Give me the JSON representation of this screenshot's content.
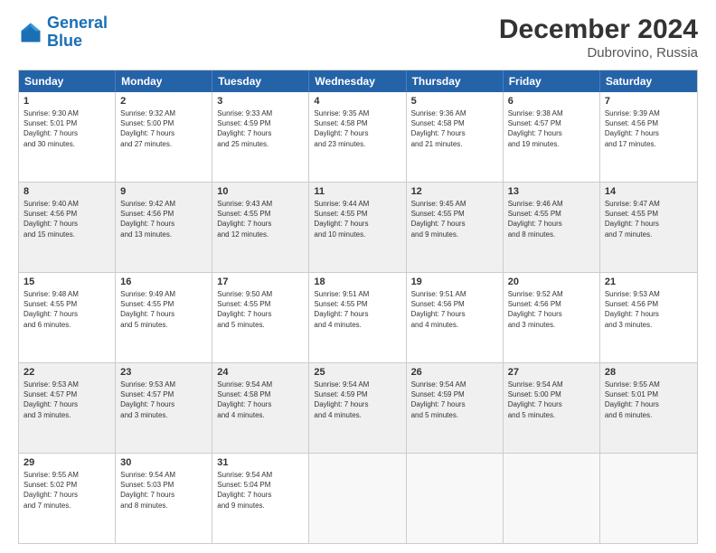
{
  "logo": {
    "line1": "General",
    "line2": "Blue"
  },
  "title": {
    "month": "December 2024",
    "location": "Dubrovino, Russia"
  },
  "header_days": [
    "Sunday",
    "Monday",
    "Tuesday",
    "Wednesday",
    "Thursday",
    "Friday",
    "Saturday"
  ],
  "weeks": [
    [
      {
        "day": "1",
        "text": "Sunrise: 9:30 AM\nSunset: 5:01 PM\nDaylight: 7 hours\nand 30 minutes.",
        "empty": false,
        "shaded": false
      },
      {
        "day": "2",
        "text": "Sunrise: 9:32 AM\nSunset: 5:00 PM\nDaylight: 7 hours\nand 27 minutes.",
        "empty": false,
        "shaded": false
      },
      {
        "day": "3",
        "text": "Sunrise: 9:33 AM\nSunset: 4:59 PM\nDaylight: 7 hours\nand 25 minutes.",
        "empty": false,
        "shaded": false
      },
      {
        "day": "4",
        "text": "Sunrise: 9:35 AM\nSunset: 4:58 PM\nDaylight: 7 hours\nand 23 minutes.",
        "empty": false,
        "shaded": false
      },
      {
        "day": "5",
        "text": "Sunrise: 9:36 AM\nSunset: 4:58 PM\nDaylight: 7 hours\nand 21 minutes.",
        "empty": false,
        "shaded": false
      },
      {
        "day": "6",
        "text": "Sunrise: 9:38 AM\nSunset: 4:57 PM\nDaylight: 7 hours\nand 19 minutes.",
        "empty": false,
        "shaded": false
      },
      {
        "day": "7",
        "text": "Sunrise: 9:39 AM\nSunset: 4:56 PM\nDaylight: 7 hours\nand 17 minutes.",
        "empty": false,
        "shaded": false
      }
    ],
    [
      {
        "day": "8",
        "text": "Sunrise: 9:40 AM\nSunset: 4:56 PM\nDaylight: 7 hours\nand 15 minutes.",
        "empty": false,
        "shaded": true
      },
      {
        "day": "9",
        "text": "Sunrise: 9:42 AM\nSunset: 4:56 PM\nDaylight: 7 hours\nand 13 minutes.",
        "empty": false,
        "shaded": true
      },
      {
        "day": "10",
        "text": "Sunrise: 9:43 AM\nSunset: 4:55 PM\nDaylight: 7 hours\nand 12 minutes.",
        "empty": false,
        "shaded": true
      },
      {
        "day": "11",
        "text": "Sunrise: 9:44 AM\nSunset: 4:55 PM\nDaylight: 7 hours\nand 10 minutes.",
        "empty": false,
        "shaded": true
      },
      {
        "day": "12",
        "text": "Sunrise: 9:45 AM\nSunset: 4:55 PM\nDaylight: 7 hours\nand 9 minutes.",
        "empty": false,
        "shaded": true
      },
      {
        "day": "13",
        "text": "Sunrise: 9:46 AM\nSunset: 4:55 PM\nDaylight: 7 hours\nand 8 minutes.",
        "empty": false,
        "shaded": true
      },
      {
        "day": "14",
        "text": "Sunrise: 9:47 AM\nSunset: 4:55 PM\nDaylight: 7 hours\nand 7 minutes.",
        "empty": false,
        "shaded": true
      }
    ],
    [
      {
        "day": "15",
        "text": "Sunrise: 9:48 AM\nSunset: 4:55 PM\nDaylight: 7 hours\nand 6 minutes.",
        "empty": false,
        "shaded": false
      },
      {
        "day": "16",
        "text": "Sunrise: 9:49 AM\nSunset: 4:55 PM\nDaylight: 7 hours\nand 5 minutes.",
        "empty": false,
        "shaded": false
      },
      {
        "day": "17",
        "text": "Sunrise: 9:50 AM\nSunset: 4:55 PM\nDaylight: 7 hours\nand 5 minutes.",
        "empty": false,
        "shaded": false
      },
      {
        "day": "18",
        "text": "Sunrise: 9:51 AM\nSunset: 4:55 PM\nDaylight: 7 hours\nand 4 minutes.",
        "empty": false,
        "shaded": false
      },
      {
        "day": "19",
        "text": "Sunrise: 9:51 AM\nSunset: 4:56 PM\nDaylight: 7 hours\nand 4 minutes.",
        "empty": false,
        "shaded": false
      },
      {
        "day": "20",
        "text": "Sunrise: 9:52 AM\nSunset: 4:56 PM\nDaylight: 7 hours\nand 3 minutes.",
        "empty": false,
        "shaded": false
      },
      {
        "day": "21",
        "text": "Sunrise: 9:53 AM\nSunset: 4:56 PM\nDaylight: 7 hours\nand 3 minutes.",
        "empty": false,
        "shaded": false
      }
    ],
    [
      {
        "day": "22",
        "text": "Sunrise: 9:53 AM\nSunset: 4:57 PM\nDaylight: 7 hours\nand 3 minutes.",
        "empty": false,
        "shaded": true
      },
      {
        "day": "23",
        "text": "Sunrise: 9:53 AM\nSunset: 4:57 PM\nDaylight: 7 hours\nand 3 minutes.",
        "empty": false,
        "shaded": true
      },
      {
        "day": "24",
        "text": "Sunrise: 9:54 AM\nSunset: 4:58 PM\nDaylight: 7 hours\nand 4 minutes.",
        "empty": false,
        "shaded": true
      },
      {
        "day": "25",
        "text": "Sunrise: 9:54 AM\nSunset: 4:59 PM\nDaylight: 7 hours\nand 4 minutes.",
        "empty": false,
        "shaded": true
      },
      {
        "day": "26",
        "text": "Sunrise: 9:54 AM\nSunset: 4:59 PM\nDaylight: 7 hours\nand 5 minutes.",
        "empty": false,
        "shaded": true
      },
      {
        "day": "27",
        "text": "Sunrise: 9:54 AM\nSunset: 5:00 PM\nDaylight: 7 hours\nand 5 minutes.",
        "empty": false,
        "shaded": true
      },
      {
        "day": "28",
        "text": "Sunrise: 9:55 AM\nSunset: 5:01 PM\nDaylight: 7 hours\nand 6 minutes.",
        "empty": false,
        "shaded": true
      }
    ],
    [
      {
        "day": "29",
        "text": "Sunrise: 9:55 AM\nSunset: 5:02 PM\nDaylight: 7 hours\nand 7 minutes.",
        "empty": false,
        "shaded": false
      },
      {
        "day": "30",
        "text": "Sunrise: 9:54 AM\nSunset: 5:03 PM\nDaylight: 7 hours\nand 8 minutes.",
        "empty": false,
        "shaded": false
      },
      {
        "day": "31",
        "text": "Sunrise: 9:54 AM\nSunset: 5:04 PM\nDaylight: 7 hours\nand 9 minutes.",
        "empty": false,
        "shaded": false
      },
      {
        "day": "",
        "text": "",
        "empty": true,
        "shaded": false
      },
      {
        "day": "",
        "text": "",
        "empty": true,
        "shaded": false
      },
      {
        "day": "",
        "text": "",
        "empty": true,
        "shaded": false
      },
      {
        "day": "",
        "text": "",
        "empty": true,
        "shaded": false
      }
    ]
  ]
}
